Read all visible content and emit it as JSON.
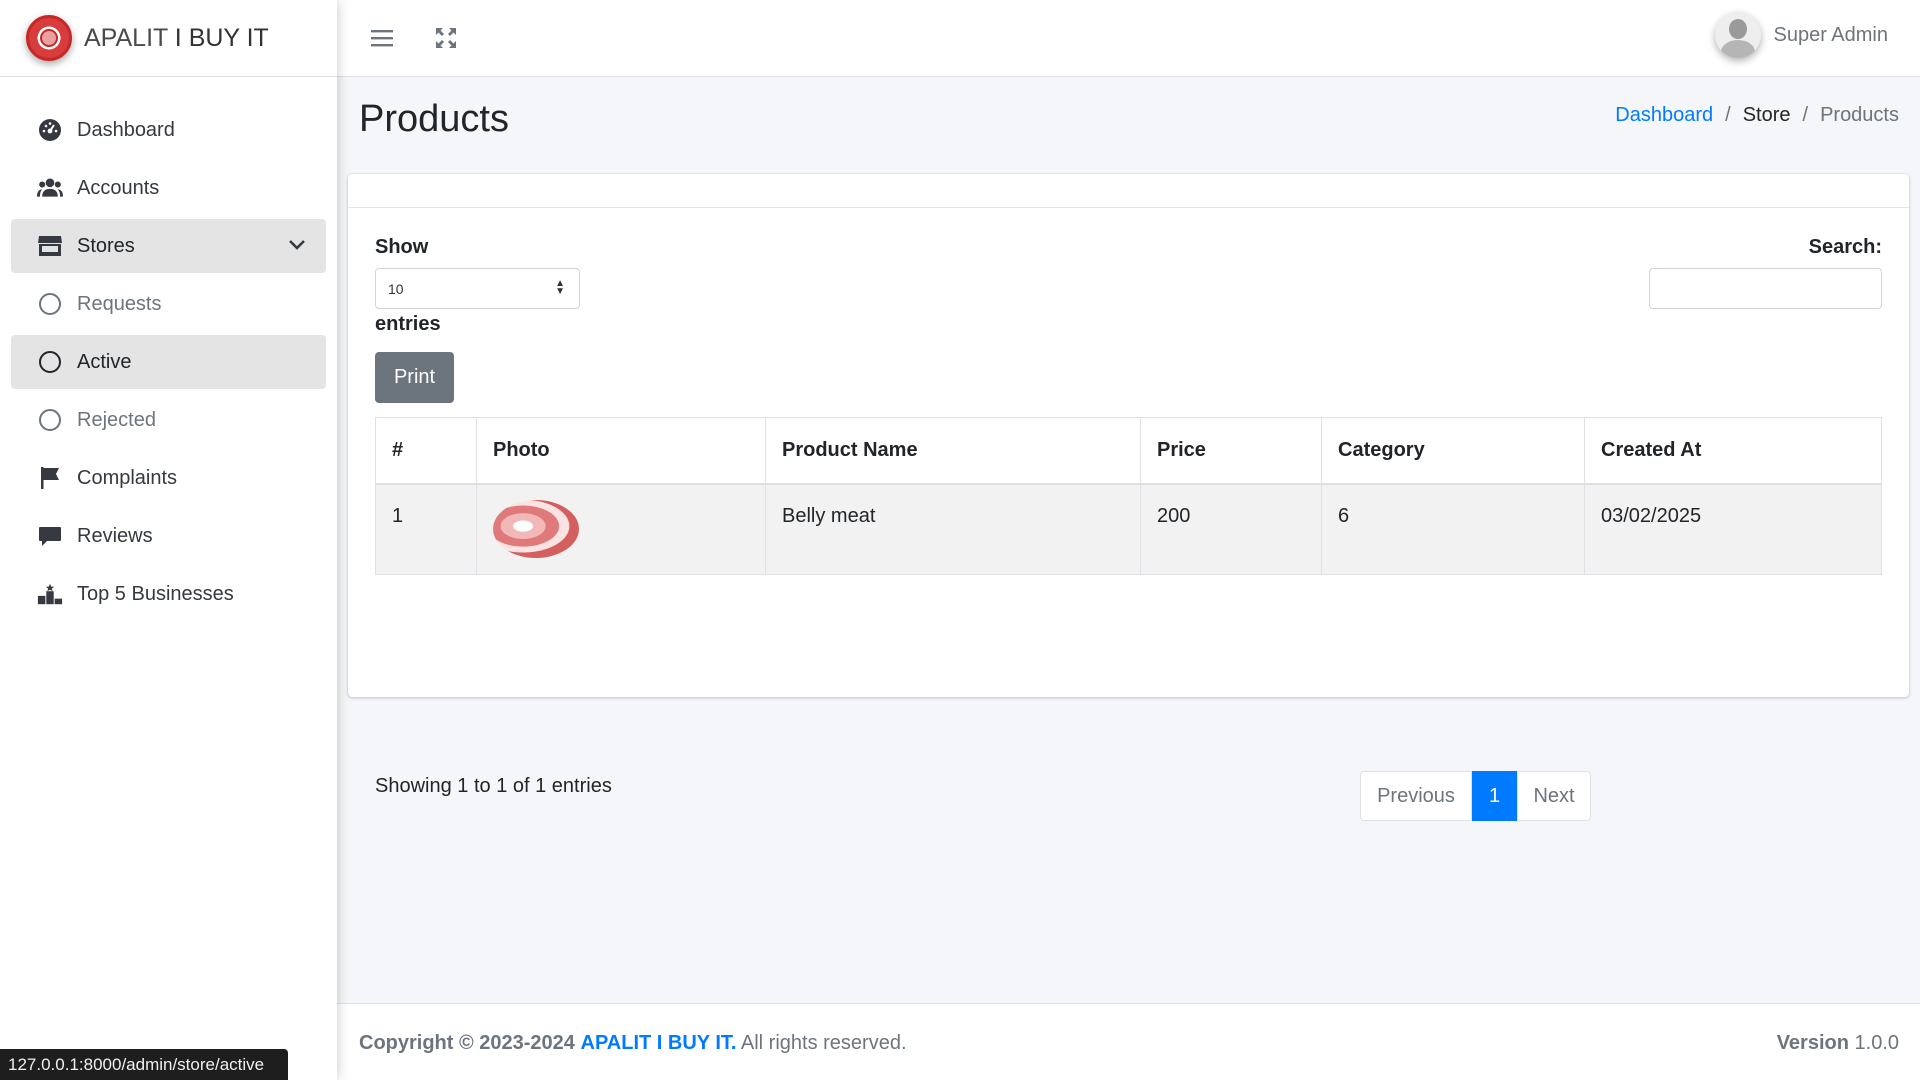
{
  "brand": {
    "part1": "APALIT",
    "part2": "I BUY IT"
  },
  "sidebar": {
    "items": [
      {
        "label": "Dashboard"
      },
      {
        "label": "Accounts"
      },
      {
        "label": "Stores"
      },
      {
        "label": "Requests"
      },
      {
        "label": "Active"
      },
      {
        "label": "Rejected"
      },
      {
        "label": "Complaints"
      },
      {
        "label": "Reviews"
      },
      {
        "label": "Top 5 Businesses"
      }
    ]
  },
  "topbar": {
    "user_name": "Super Admin"
  },
  "page": {
    "title": "Products"
  },
  "breadcrumb": {
    "items": [
      "Dashboard",
      "Store",
      "Products"
    ],
    "separator": "/"
  },
  "table_controls": {
    "show_label": "Show",
    "page_size": "10",
    "entries_label": "entries",
    "print_label": "Print",
    "search_label": "Search:",
    "search_value": ""
  },
  "table": {
    "headers": [
      "#",
      "Photo",
      "Product Name",
      "Price",
      "Category",
      "Created At"
    ],
    "rows": [
      {
        "num": "1",
        "photo": "belly-meat-photo",
        "name": "Belly meat",
        "price": "200",
        "category": "6",
        "created": "03/02/2025"
      }
    ]
  },
  "pagination": {
    "info": "Showing 1 to 1 of 1 entries",
    "previous": "Previous",
    "current": "1",
    "next": "Next"
  },
  "footer": {
    "copyright": "Copyright © 2023-2024",
    "brand": "APALIT I BUY IT.",
    "rights": "All rights reserved.",
    "version_label": "Version",
    "version": "1.0.0"
  },
  "status_bar": {
    "url": "127.0.0.1:8000/admin/store/active"
  },
  "colors": {
    "primary": "#007bff",
    "secondary": "#6c757d",
    "active_bg": "#e4e4e4",
    "page_bg": "#f4f6f9"
  }
}
